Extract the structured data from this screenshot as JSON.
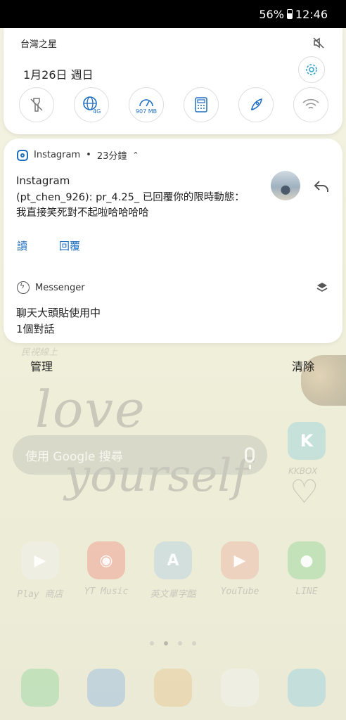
{
  "status_bar": {
    "battery": "56%",
    "time": "12:46"
  },
  "quick_settings": {
    "carrier": "台灣之星",
    "date": "1月26日 週日",
    "data_usage": "907 MB",
    "network_badge": "4G",
    "icons": [
      "flashlight-off-icon",
      "mobile-data-icon",
      "data-usage-icon",
      "calculator-icon",
      "rocket-icon",
      "wifi-icon"
    ]
  },
  "instagram": {
    "app_name": "Instagram",
    "separator": "•",
    "time_ago": "23分鐘",
    "title": "Instagram",
    "body": "(pt_chen_926): pr_4.25_ 已回覆你的限時動態：我直接笑死對不起啦哈哈哈哈",
    "actions": {
      "read": "讀",
      "reply": "回覆"
    }
  },
  "messenger": {
    "app_name": "Messenger",
    "line1": "聊天大頭貼使用中",
    "line2": "1個對話"
  },
  "panel_footer": {
    "manage": "管理",
    "clear": "清除"
  },
  "home": {
    "wallpaper_brand": "民視線上",
    "wallpaper_love": "love",
    "wallpaper_yourself": "yourself",
    "search_placeholder": "使用 Google 搜尋",
    "kkbox_label": "KKBOX",
    "apps": [
      {
        "label": "Play 商店"
      },
      {
        "label": "YT Music"
      },
      {
        "label": "英文單字酷"
      },
      {
        "label": "YouTube"
      },
      {
        "label": "LINE"
      }
    ]
  },
  "colors": {
    "accent": "#1f6fbf",
    "teal_accent": "#3aa6c8"
  }
}
